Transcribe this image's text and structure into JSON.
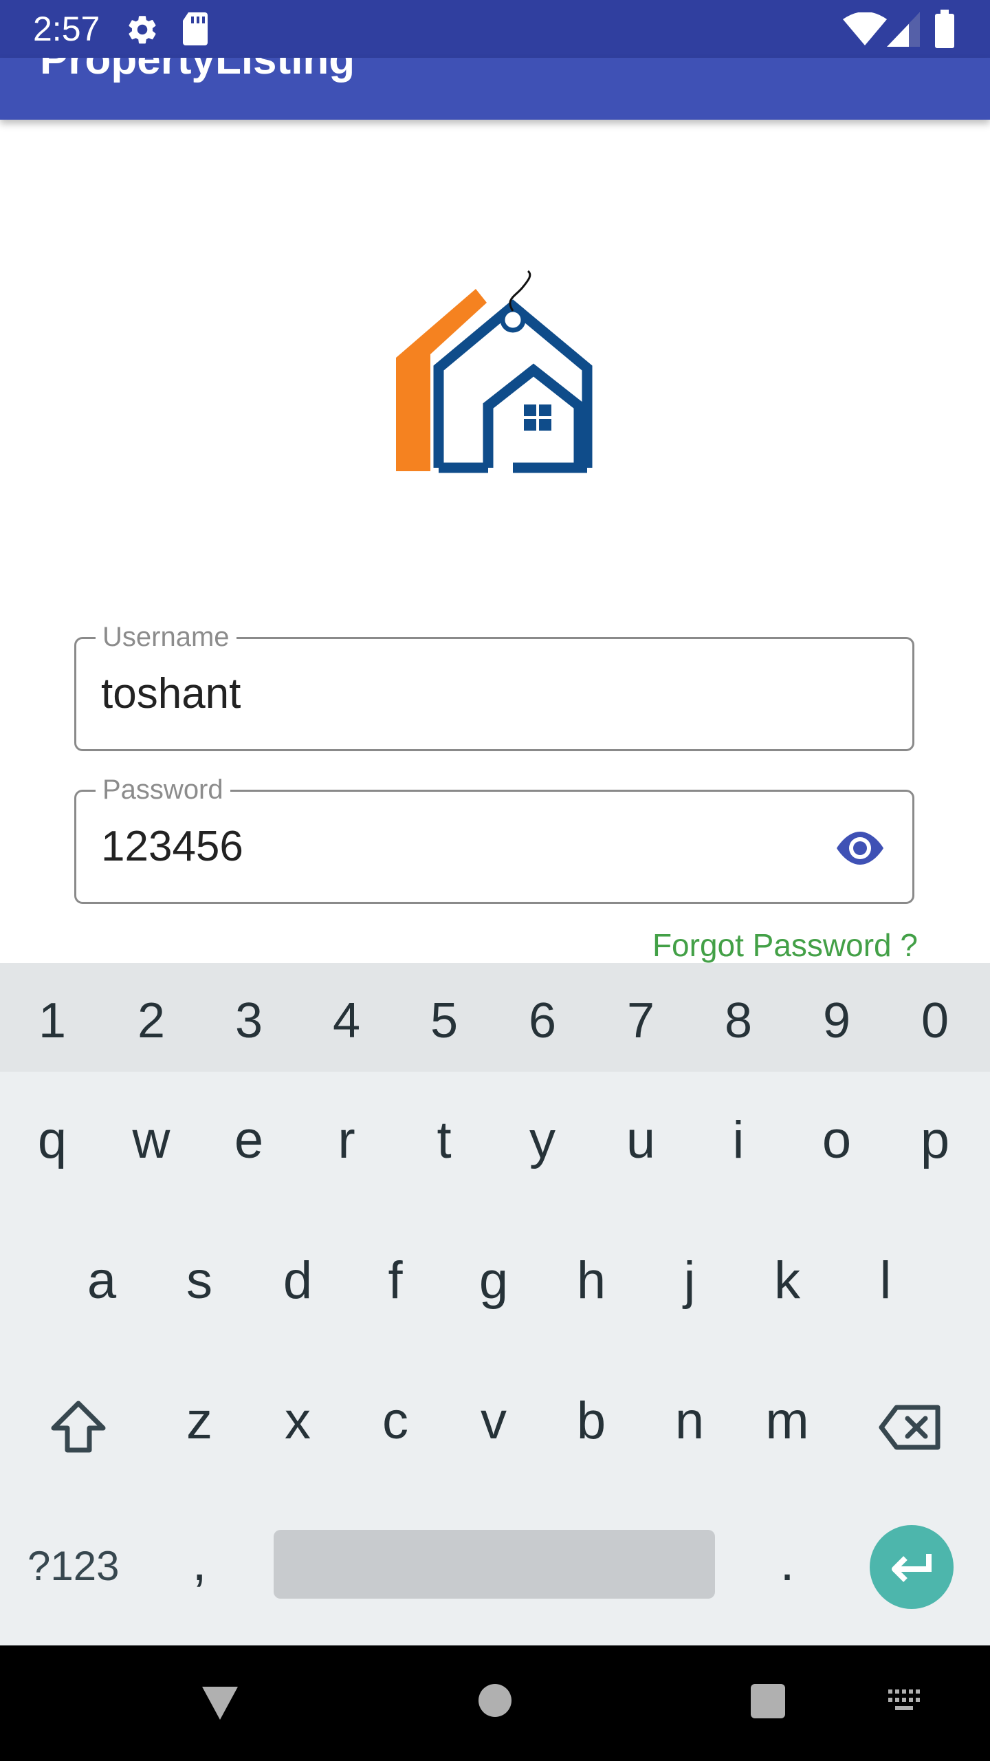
{
  "status_bar": {
    "time": "2:57",
    "icons": [
      "gear-icon",
      "sd-card-icon",
      "wifi-icon",
      "signal-icon",
      "battery-icon"
    ],
    "background": "#303F9F"
  },
  "app_bar": {
    "title": "PropertyListing",
    "background": "#3F51B5"
  },
  "logo": {
    "name": "house-tag-logo",
    "colors": {
      "orange": "#F58220",
      "blue": "#0F4C8A"
    }
  },
  "form": {
    "username": {
      "label": "Username",
      "value": "toshant"
    },
    "password": {
      "label": "Password",
      "value": "123456",
      "toggle_icon": "eye-icon",
      "toggle_color": "#3F51B5"
    },
    "forgot_password": "Forgot Password ?",
    "forgot_color": "#43A047"
  },
  "keyboard": {
    "number_row": [
      "1",
      "2",
      "3",
      "4",
      "5",
      "6",
      "7",
      "8",
      "9",
      "0"
    ],
    "row1": [
      "q",
      "w",
      "e",
      "r",
      "t",
      "y",
      "u",
      "i",
      "o",
      "p"
    ],
    "row2": [
      "a",
      "s",
      "d",
      "f",
      "g",
      "h",
      "j",
      "k",
      "l"
    ],
    "row3": [
      "z",
      "x",
      "c",
      "v",
      "b",
      "n",
      "m"
    ],
    "symbols_key": "?123",
    "comma_key": ",",
    "period_key": ".",
    "enter_color": "#4DB6AC"
  },
  "nav_bar": {
    "icons": [
      "back-icon",
      "home-icon",
      "recents-icon",
      "keyboard-switch-icon"
    ]
  }
}
